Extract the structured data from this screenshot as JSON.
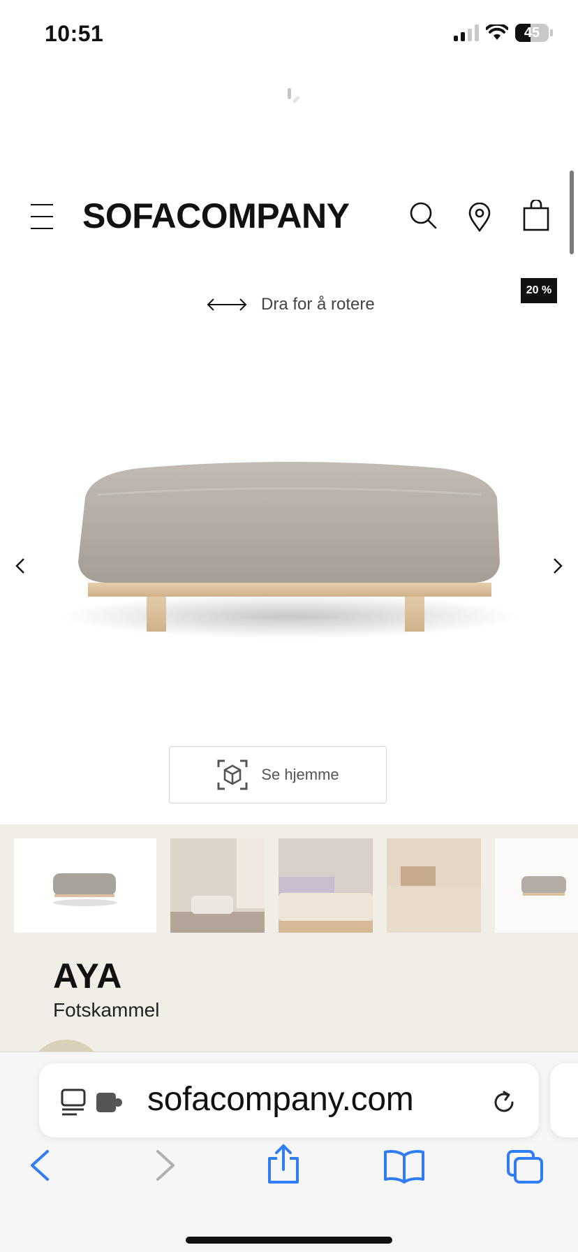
{
  "status_bar": {
    "time": "10:51",
    "battery": "45",
    "battery_level": 0.45
  },
  "header": {
    "brand": "SOFACOMPANY",
    "icons": [
      "menu-icon",
      "search-icon",
      "location-pin-icon",
      "shopping-bag-icon"
    ]
  },
  "gallery": {
    "discount_badge": "20 %",
    "rotate_hint": "Dra for å rotere",
    "ar_button_label": "Se hjemme"
  },
  "product": {
    "name": "AYA",
    "category": "Fotskammel",
    "thumbnail_count": 5
  },
  "browser": {
    "url": "sofacompany.com",
    "toolbar_icons": [
      "back-icon",
      "forward-icon",
      "share-icon",
      "bookmarks-icon",
      "tabs-icon"
    ]
  },
  "colors": {
    "beige_bg": "#f1eee7",
    "badge_bg": "#111111",
    "safari_blue": "#2f7cf6",
    "upholstery": "#b3aca5",
    "wood": "#dcc09c"
  }
}
